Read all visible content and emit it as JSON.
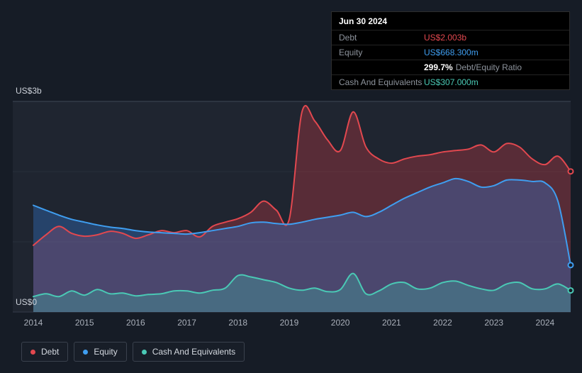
{
  "colors": {
    "debt": "#e2484f",
    "equity": "#3f9ef0",
    "cash": "#4ac9b5",
    "page_background": "#161c26",
    "plot_background": "#1f2530",
    "tooltip_background": "#000000"
  },
  "tooltip": {
    "date": "Jun 30 2024",
    "debt_label": "Debt",
    "debt_value": "US$2.003b",
    "equity_label": "Equity",
    "equity_value": "US$668.300m",
    "ratio_value": "299.7%",
    "ratio_label": "Debt/Equity Ratio",
    "cash_label": "Cash And Equivalents",
    "cash_value": "US$307.000m"
  },
  "axis": {
    "y_top": "US$3b",
    "y_bottom": "US$0"
  },
  "legend": [
    {
      "label": "Debt",
      "color_key": "debt"
    },
    {
      "label": "Equity",
      "color_key": "equity"
    },
    {
      "label": "Cash And Equivalents",
      "color_key": "cash"
    }
  ],
  "chart_data": {
    "type": "area",
    "title": "",
    "xlabel": "",
    "ylabel": "",
    "y_unit": "US$ billions",
    "ylim": [
      0,
      3
    ],
    "grid": true,
    "legend_position": "bottom-left",
    "x_ticks": [
      "2014",
      "2015",
      "2016",
      "2017",
      "2018",
      "2019",
      "2020",
      "2021",
      "2022",
      "2023",
      "2024"
    ],
    "x_tick_years": [
      2014,
      2015,
      2016,
      2017,
      2018,
      2019,
      2020,
      2021,
      2022,
      2023,
      2024
    ],
    "x": [
      2014,
      2014.25,
      2014.5,
      2014.75,
      2015,
      2015.25,
      2015.5,
      2015.75,
      2016,
      2016.25,
      2016.5,
      2016.75,
      2017,
      2017.25,
      2017.5,
      2017.75,
      2018,
      2018.25,
      2018.5,
      2018.75,
      2019,
      2019.25,
      2019.5,
      2019.75,
      2020,
      2020.25,
      2020.5,
      2020.75,
      2021,
      2021.25,
      2021.5,
      2021.75,
      2022,
      2022.25,
      2022.5,
      2022.75,
      2023,
      2023.25,
      2023.5,
      2023.75,
      2024,
      2024.25,
      2024.5
    ],
    "series": [
      {
        "name": "Debt",
        "color_key": "debt",
        "fill": "rgba(222,62,72,0.30)",
        "values": [
          0.95,
          1.1,
          1.22,
          1.12,
          1.08,
          1.1,
          1.15,
          1.12,
          1.05,
          1.1,
          1.16,
          1.13,
          1.16,
          1.07,
          1.22,
          1.28,
          1.33,
          1.42,
          1.58,
          1.45,
          1.32,
          2.85,
          2.72,
          2.45,
          2.3,
          2.85,
          2.35,
          2.18,
          2.12,
          2.18,
          2.22,
          2.24,
          2.28,
          2.3,
          2.32,
          2.38,
          2.28,
          2.4,
          2.35,
          2.18,
          2.1,
          2.22,
          2.003
        ]
      },
      {
        "name": "Equity",
        "color_key": "equity",
        "fill": "rgba(52,122,215,0.35)",
        "values": [
          1.52,
          1.45,
          1.38,
          1.32,
          1.28,
          1.24,
          1.21,
          1.19,
          1.16,
          1.14,
          1.13,
          1.12,
          1.11,
          1.13,
          1.16,
          1.19,
          1.22,
          1.27,
          1.28,
          1.26,
          1.25,
          1.28,
          1.32,
          1.35,
          1.38,
          1.42,
          1.36,
          1.42,
          1.52,
          1.62,
          1.7,
          1.78,
          1.84,
          1.9,
          1.86,
          1.78,
          1.8,
          1.88,
          1.88,
          1.86,
          1.84,
          1.58,
          0.6683
        ]
      },
      {
        "name": "Cash And Equivalents",
        "color_key": "cash",
        "fill": "rgba(64,196,178,0.28)",
        "values": [
          0.22,
          0.26,
          0.22,
          0.3,
          0.24,
          0.32,
          0.26,
          0.27,
          0.23,
          0.25,
          0.26,
          0.3,
          0.3,
          0.27,
          0.31,
          0.34,
          0.52,
          0.5,
          0.46,
          0.42,
          0.34,
          0.31,
          0.34,
          0.29,
          0.32,
          0.55,
          0.26,
          0.3,
          0.4,
          0.42,
          0.33,
          0.34,
          0.42,
          0.44,
          0.38,
          0.33,
          0.31,
          0.4,
          0.42,
          0.33,
          0.33,
          0.4,
          0.307
        ]
      }
    ]
  }
}
